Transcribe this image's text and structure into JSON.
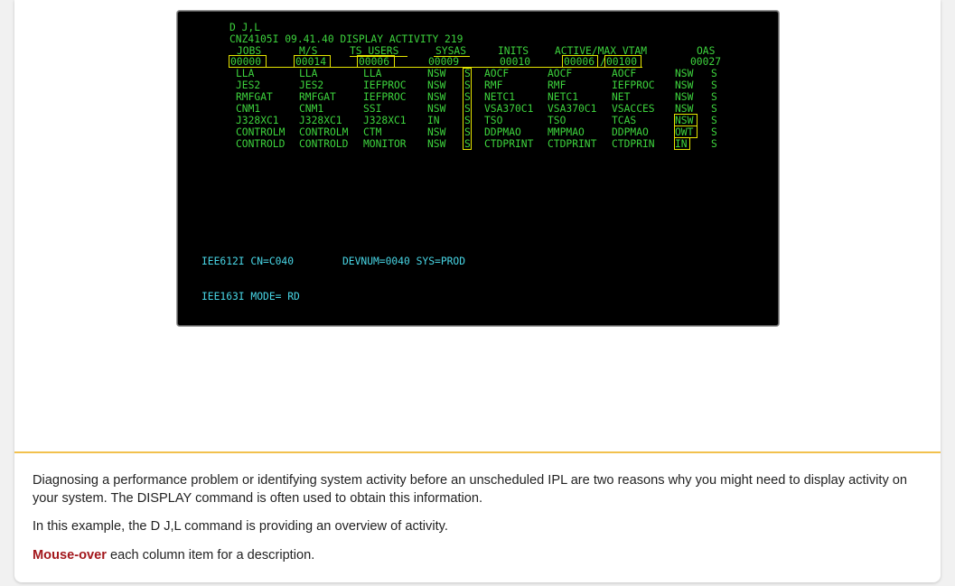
{
  "terminal": {
    "command": "D J,L",
    "header": "CNZ4105I 09.41.40 DISPLAY ACTIVITY 219",
    "col_headers": {
      "jobs": "JOBS",
      "ms": "M/S",
      "ts_users": "TS USERS",
      "sysas": "SYSAS",
      "inits": "INITS",
      "active_max_vtam": "ACTIVE/MAX VTAM",
      "oas": "OAS"
    },
    "counts": {
      "jobs": "00000",
      "ms": "00014",
      "ts_users": "00006",
      "sysas": "00009",
      "inits": "00010",
      "active": "00006",
      "max": "00100",
      "oas": "00027"
    },
    "rows": [
      {
        "c1": "LLA",
        "c2": "LLA",
        "c3": "LLA",
        "c4": "NSW",
        "c5": "S",
        "c6": "AOCF",
        "c7": "AOCF",
        "c8": "AOCF",
        "c9": "NSW",
        "c10": "S"
      },
      {
        "c1": "JES2",
        "c2": "JES2",
        "c3": "IEFPROC",
        "c4": "NSW",
        "c5": "S",
        "c6": "RMF",
        "c7": "RMF",
        "c8": "IEFPROC",
        "c9": "NSW",
        "c10": "S"
      },
      {
        "c1": "RMFGAT",
        "c2": "RMFGAT",
        "c3": "IEFPROC",
        "c4": "NSW",
        "c5": "S",
        "c6": "NETC1",
        "c7": "NETC1",
        "c8": "NET",
        "c9": "NSW",
        "c10": "S"
      },
      {
        "c1": "CNM1",
        "c2": "CNM1",
        "c3": "SSI",
        "c4": "NSW",
        "c5": "S",
        "c6": "VSA370C1",
        "c7": "VSA370C1",
        "c8": "VSACCES",
        "c9": "NSW",
        "c10": "S"
      },
      {
        "c1": "J328XC1",
        "c2": "J328XC1",
        "c3": "J328XC1",
        "c4": "IN",
        "c5": "S",
        "c6": "TSO",
        "c7": "TSO",
        "c8": "TCAS",
        "c9": "NSW",
        "c10": "S"
      },
      {
        "c1": "CONTROLM",
        "c2": "CONTROLM",
        "c3": "CTM",
        "c4": "NSW",
        "c5": "S",
        "c6": "DDPMAO",
        "c7": "MMPMAO",
        "c8": "DDPMAO",
        "c9": "OWT",
        "c10": "S"
      },
      {
        "c1": "CONTROLD",
        "c2": "CONTROLD",
        "c3": "MONITOR",
        "c4": "NSW",
        "c5": "S",
        "c6": "CTDPRINT",
        "c7": "CTDPRINT",
        "c8": "CTDPRIN",
        "c9": "IN",
        "c10": "S"
      }
    ],
    "msg1_a": "IEE612I CN=C040",
    "msg1_b": "DEVNUM=0040 SYS=PROD",
    "msg2": "IEE163I MODE= RD"
  },
  "text": {
    "p1": "Diagnosing a performance problem or identifying system activity before an unscheduled IPL are two reasons why you might need to display activity on your system. The DISPLAY command is often used to obtain this information.",
    "p2": "In this example, the D J,L command is providing an overview of activity.",
    "p3_highlight": "Mouse-over",
    "p3_rest": " each column item for a description."
  },
  "colors": {
    "terminal_bg": "#000000",
    "terminal_green": "#3dd33d",
    "terminal_cyan": "#48d6e6",
    "hotspot_yellow": "#e6e600",
    "divider": "#f2c14e",
    "mouseover_red": "#a3171c"
  }
}
